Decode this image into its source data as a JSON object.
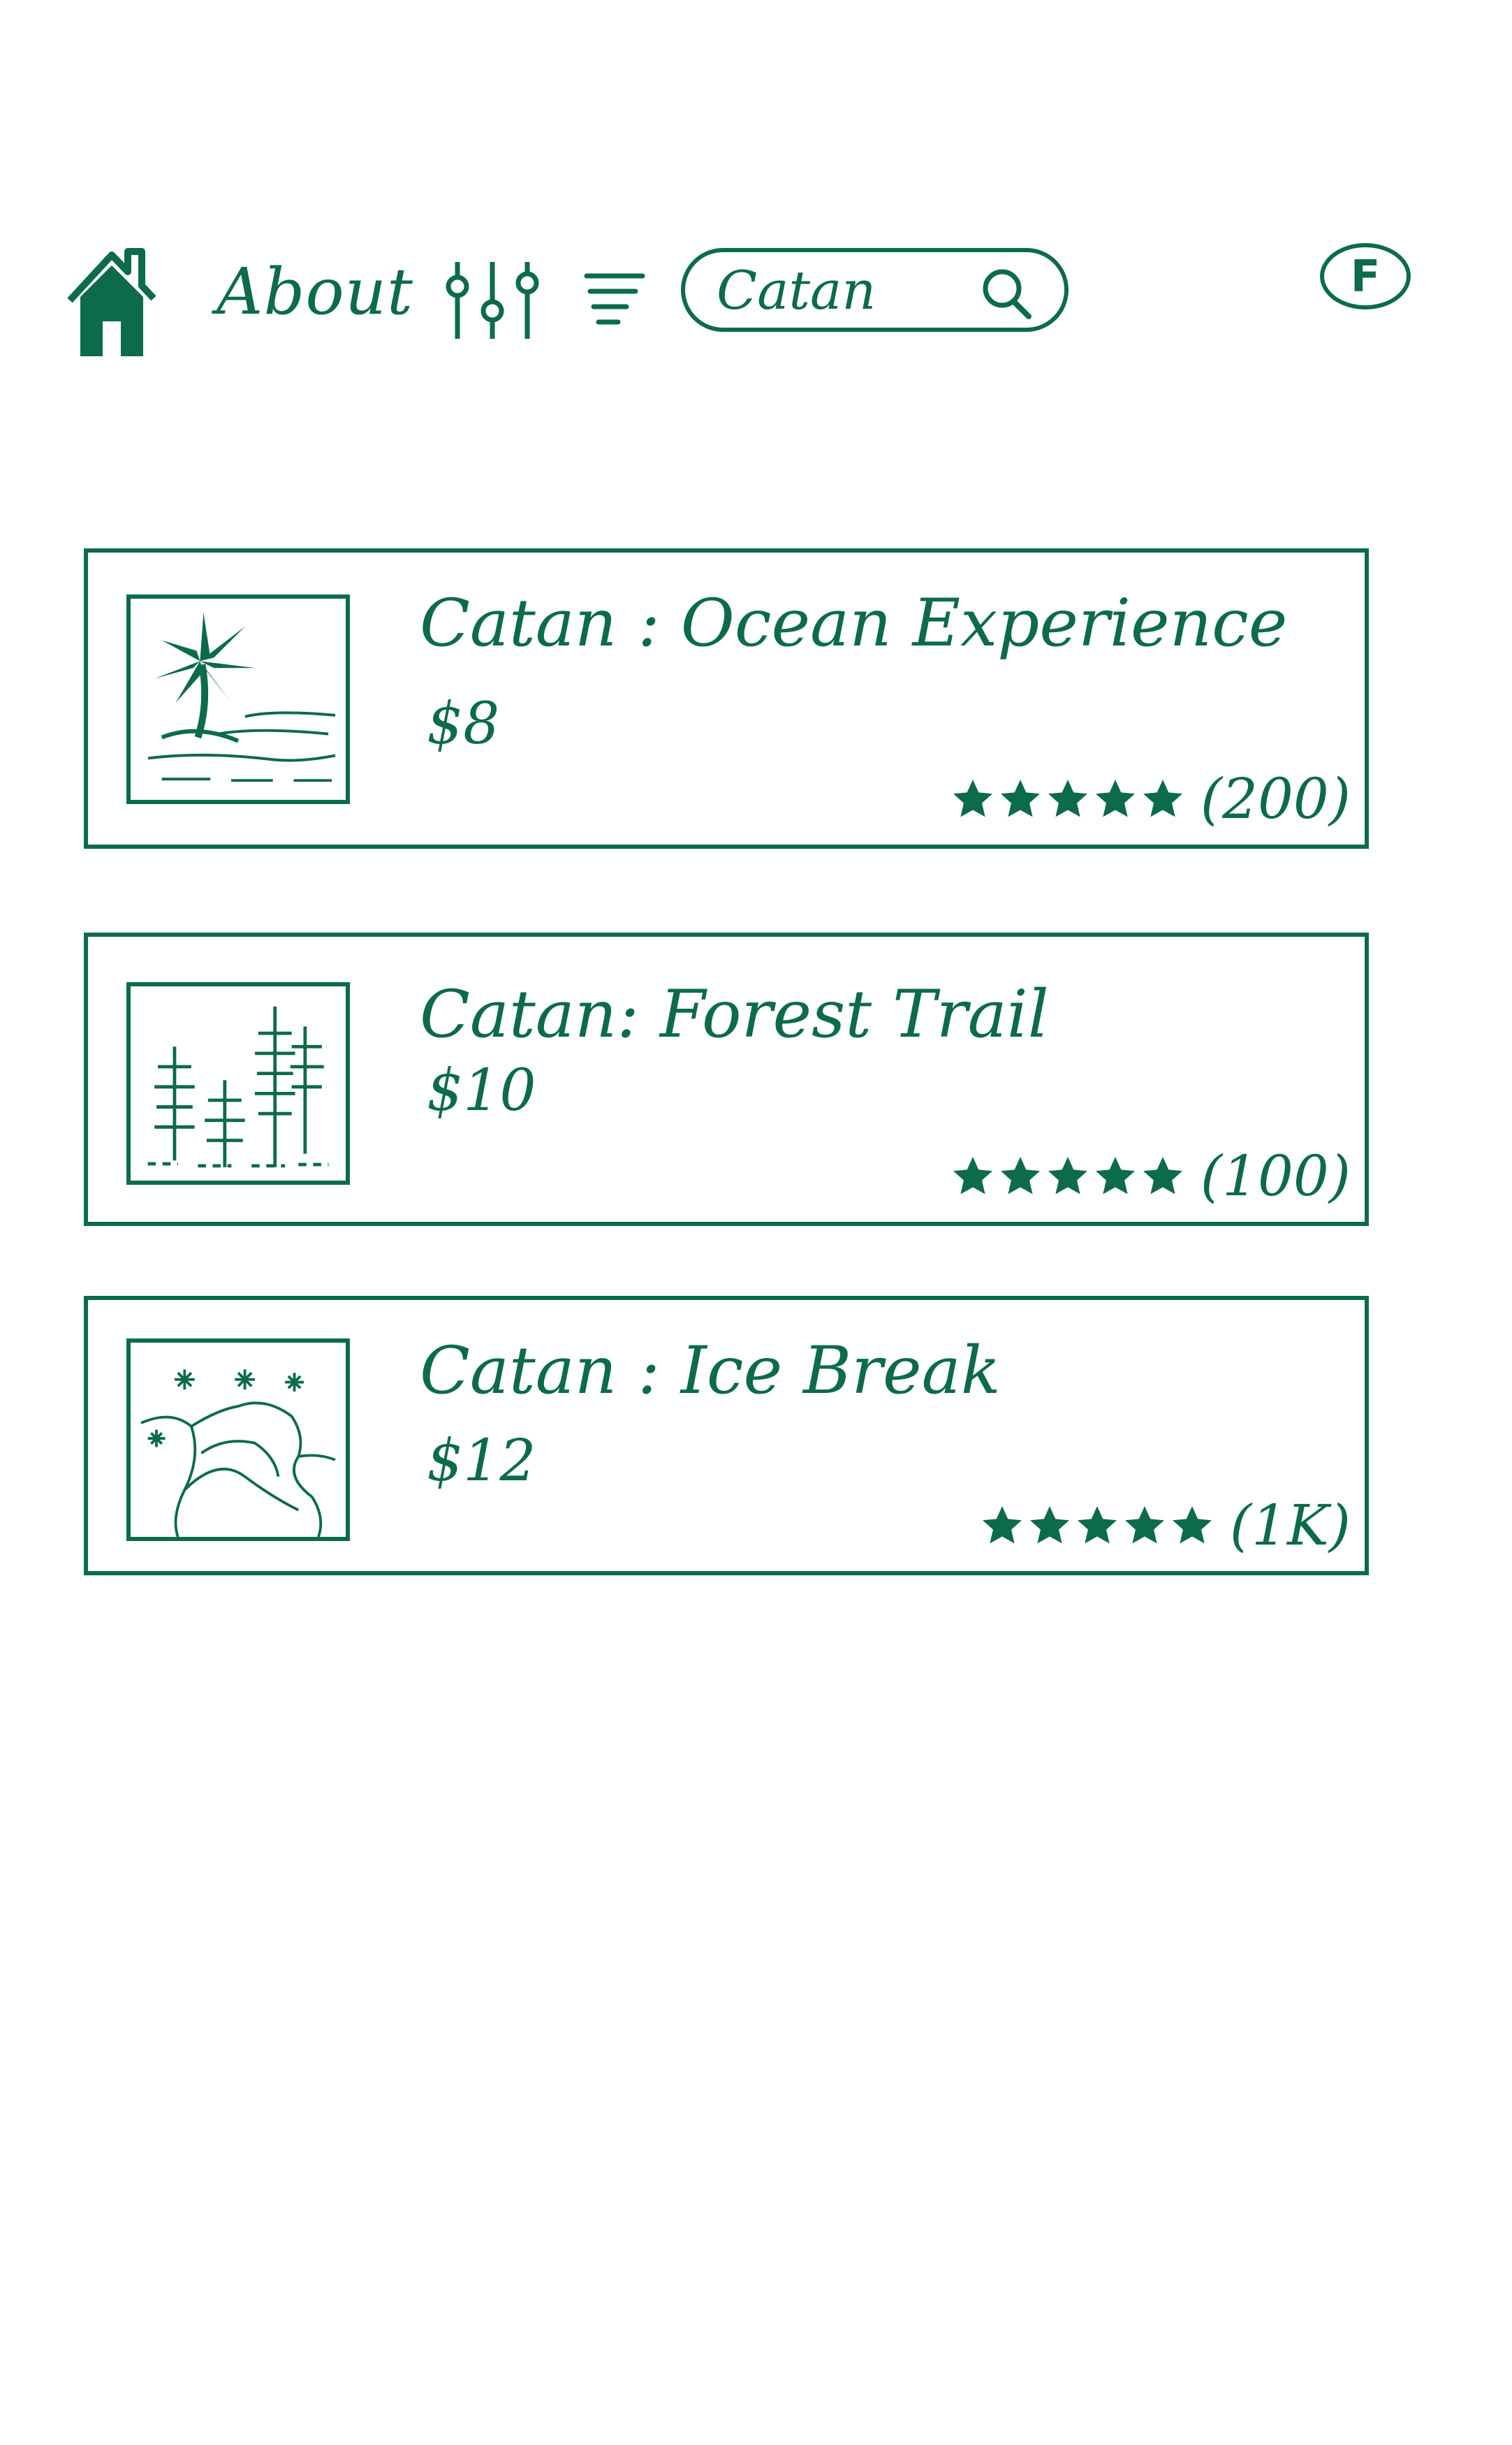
{
  "theme": {
    "ink_color": "#0c6b4a",
    "background": "#ffffff"
  },
  "header": {
    "home_icon": "home-icon",
    "about_label": "About",
    "filters_icon": "sliders-icon",
    "sort_icon": "menu-icon",
    "search": {
      "value": "Catan",
      "icon": "search-icon"
    },
    "profile_initial": "F"
  },
  "results": [
    {
      "title": "Catan : Ocean Experience",
      "price": "$8",
      "rating": 5,
      "rating_count": "(200)",
      "thumbnail": "palm-beach-image"
    },
    {
      "title": "Catan: Forest Trail",
      "price": "$10",
      "rating": 5,
      "rating_count": "(100)",
      "thumbnail": "forest-image"
    },
    {
      "title": "Catan : Ice Break",
      "price": "$12",
      "rating": 5,
      "rating_count": "(1K)",
      "thumbnail": "snow-landscape-image"
    }
  ]
}
